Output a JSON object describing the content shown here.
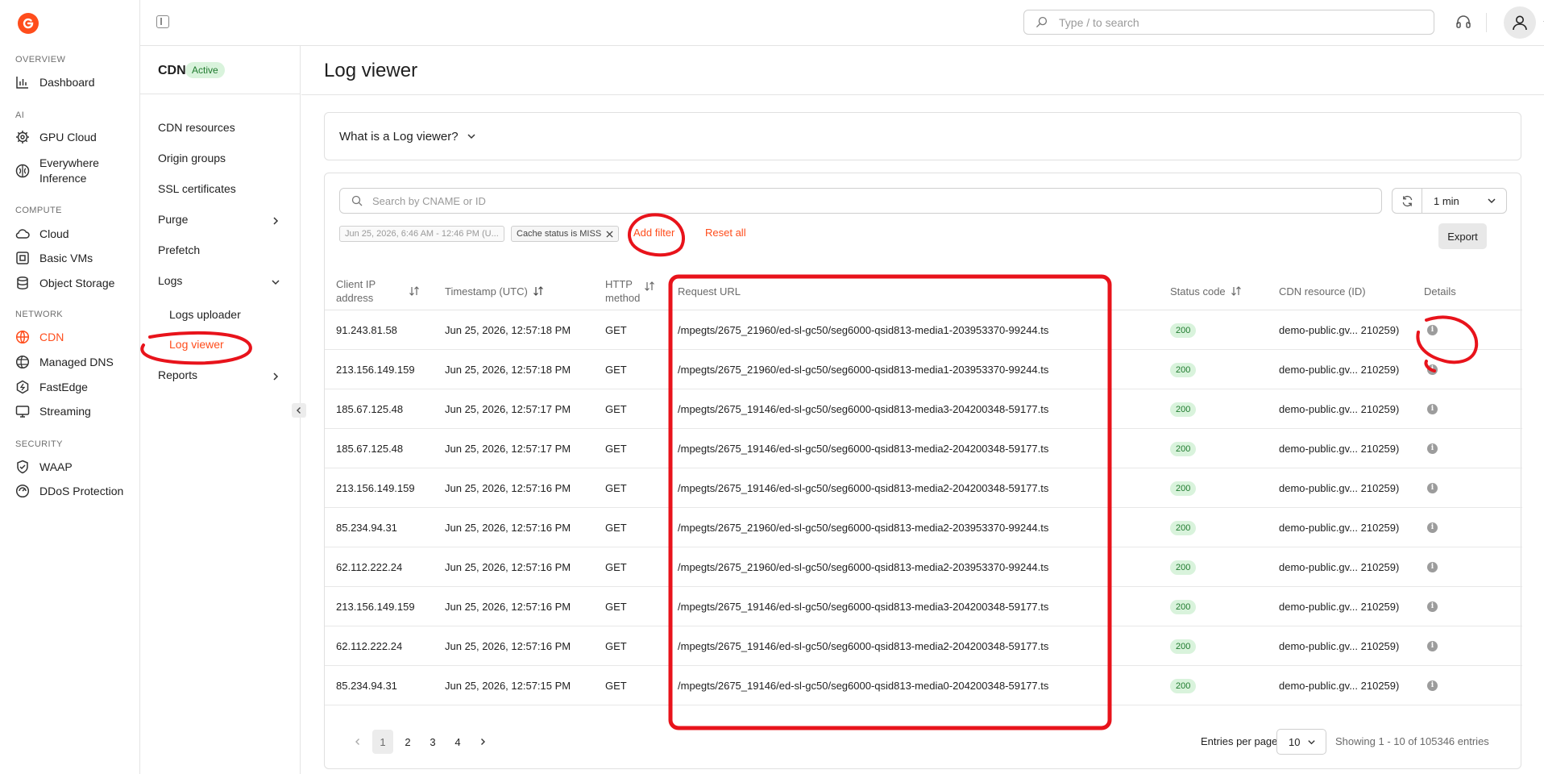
{
  "sidebar": {
    "sections": [
      {
        "label": "OVERVIEW",
        "items": [
          {
            "label": "Dashboard",
            "icon": "bar-chart-icon"
          }
        ]
      },
      {
        "label": "AI",
        "items": [
          {
            "label": "GPU Cloud",
            "icon": "gear-chip-icon"
          },
          {
            "label": "Everywhere\nInference",
            "icon": "brain-icon"
          }
        ]
      },
      {
        "label": "COMPUTE",
        "items": [
          {
            "label": "Cloud",
            "icon": "cloud-icon"
          },
          {
            "label": "Basic VMs",
            "icon": "vm-icon"
          },
          {
            "label": "Object Storage",
            "icon": "database-icon"
          }
        ]
      },
      {
        "label": "NETWORK",
        "items": [
          {
            "label": "CDN",
            "icon": "globe-icon"
          },
          {
            "label": "Managed DNS",
            "icon": "dns-icon"
          },
          {
            "label": "FastEdge",
            "icon": "hexagon-icon"
          },
          {
            "label": "Streaming",
            "icon": "monitor-icon"
          }
        ]
      },
      {
        "label": "SECURITY",
        "items": [
          {
            "label": "WAAP",
            "icon": "shield-icon"
          },
          {
            "label": "DDoS Protection",
            "icon": "ddos-icon"
          }
        ]
      }
    ],
    "active_item": "CDN"
  },
  "topbar": {
    "search_placeholder": "Type / to search"
  },
  "subnav": {
    "product": "CDN",
    "badge": "Active",
    "items": [
      "CDN resources",
      "Origin groups",
      "SSL certificates",
      "Purge",
      "Prefetch",
      "Logs",
      "Logs uploader",
      "Log viewer",
      "Reports"
    ]
  },
  "page": {
    "title": "Log viewer",
    "info_box": "What is a Log viewer?"
  },
  "filters": {
    "search_placeholder": "Search by CNAME or ID",
    "interval": "1 min",
    "date_chip": "Jun 25, 2026, 6:46 AM - 12:46 PM (U...",
    "cache_chip": "Cache status is MISS",
    "add_filter": "Add filter",
    "reset_all": "Reset all",
    "export": "Export"
  },
  "table": {
    "headers": {
      "client_ip_1": "Client IP",
      "client_ip_2": "address",
      "timestamp": "Timestamp (UTC)",
      "method_1": "HTTP",
      "method_2": "method",
      "url": "Request URL",
      "status": "Status code",
      "resource": "CDN resource (ID)",
      "details": "Details"
    },
    "rows": [
      {
        "ip": "91.243.81.58",
        "ts": "Jun 25, 2026, 12:57:18 PM",
        "method": "GET",
        "url": "/mpegts/2675_21960/ed-sl-gc50/seg6000-qsid813-media1-203953370-99244.ts",
        "status": "200",
        "resource": "demo-public.gv... 210259)"
      },
      {
        "ip": "213.156.149.159",
        "ts": "Jun 25, 2026, 12:57:18 PM",
        "method": "GET",
        "url": "/mpegts/2675_21960/ed-sl-gc50/seg6000-qsid813-media1-203953370-99244.ts",
        "status": "200",
        "resource": "demo-public.gv... 210259)"
      },
      {
        "ip": "185.67.125.48",
        "ts": "Jun 25, 2026, 12:57:17 PM",
        "method": "GET",
        "url": "/mpegts/2675_19146/ed-sl-gc50/seg6000-qsid813-media3-204200348-59177.ts",
        "status": "200",
        "resource": "demo-public.gv... 210259)"
      },
      {
        "ip": "185.67.125.48",
        "ts": "Jun 25, 2026, 12:57:17 PM",
        "method": "GET",
        "url": "/mpegts/2675_19146/ed-sl-gc50/seg6000-qsid813-media2-204200348-59177.ts",
        "status": "200",
        "resource": "demo-public.gv... 210259)"
      },
      {
        "ip": "213.156.149.159",
        "ts": "Jun 25, 2026, 12:57:16 PM",
        "method": "GET",
        "url": "/mpegts/2675_19146/ed-sl-gc50/seg6000-qsid813-media2-204200348-59177.ts",
        "status": "200",
        "resource": "demo-public.gv... 210259)"
      },
      {
        "ip": "85.234.94.31",
        "ts": "Jun 25, 2026, 12:57:16 PM",
        "method": "GET",
        "url": "/mpegts/2675_21960/ed-sl-gc50/seg6000-qsid813-media2-203953370-99244.ts",
        "status": "200",
        "resource": "demo-public.gv... 210259)"
      },
      {
        "ip": "62.112.222.24",
        "ts": "Jun 25, 2026, 12:57:16 PM",
        "method": "GET",
        "url": "/mpegts/2675_21960/ed-sl-gc50/seg6000-qsid813-media2-203953370-99244.ts",
        "status": "200",
        "resource": "demo-public.gv... 210259)"
      },
      {
        "ip": "213.156.149.159",
        "ts": "Jun 25, 2026, 12:57:16 PM",
        "method": "GET",
        "url": "/mpegts/2675_19146/ed-sl-gc50/seg6000-qsid813-media3-204200348-59177.ts",
        "status": "200",
        "resource": "demo-public.gv... 210259)"
      },
      {
        "ip": "62.112.222.24",
        "ts": "Jun 25, 2026, 12:57:16 PM",
        "method": "GET",
        "url": "/mpegts/2675_19146/ed-sl-gc50/seg6000-qsid813-media2-204200348-59177.ts",
        "status": "200",
        "resource": "demo-public.gv... 210259)"
      },
      {
        "ip": "85.234.94.31",
        "ts": "Jun 25, 2026, 12:57:15 PM",
        "method": "GET",
        "url": "/mpegts/2675_19146/ed-sl-gc50/seg6000-qsid813-media0-204200348-59177.ts",
        "status": "200",
        "resource": "demo-public.gv... 210259)"
      }
    ]
  },
  "pagination": {
    "pages": [
      "1",
      "2",
      "3",
      "4"
    ],
    "current": "1",
    "entries_label": "Entries per page",
    "entries_value": "10",
    "showing": "Showing 1 - 10 of 105346 entries"
  },
  "colors": {
    "accent": "#ff4d1c",
    "annotation": "#e8131b",
    "status_ok_bg": "#d9f3dc",
    "status_ok_text": "#1f7a2e"
  }
}
